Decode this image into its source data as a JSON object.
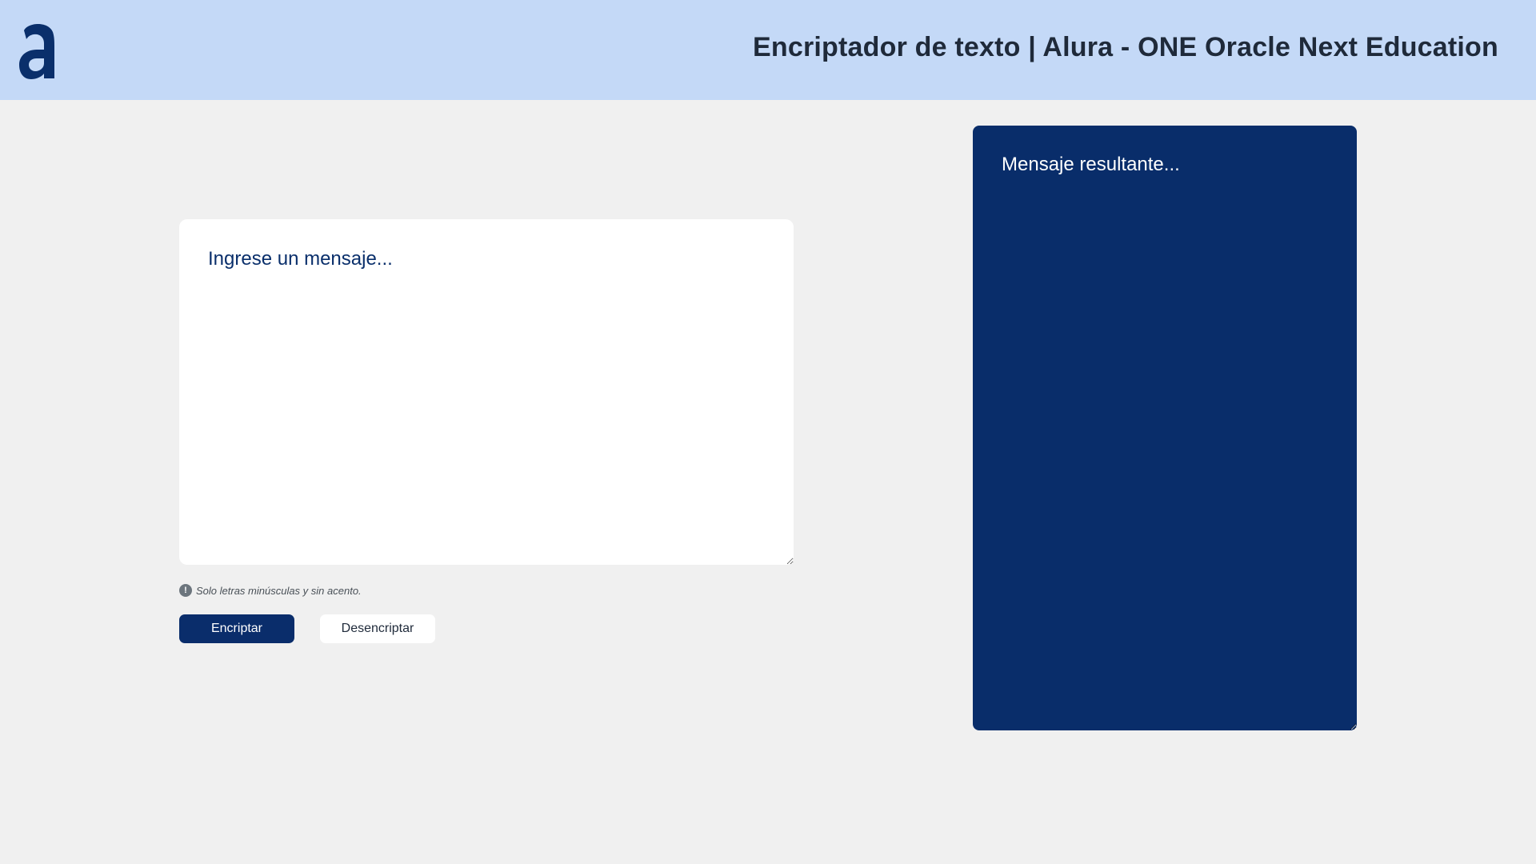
{
  "header": {
    "logo_icon": "alura-a-logo-icon",
    "title": "Encriptador de texto | Alura - ONE Oracle Next Education"
  },
  "input": {
    "placeholder": "Ingrese un mensaje...",
    "value": ""
  },
  "hint": {
    "icon": "exclamation-circle-icon",
    "text": "Solo letras minúsculas y sin acento."
  },
  "actions": {
    "encrypt_label": "Encriptar",
    "decrypt_label": "Desencriptar"
  },
  "output": {
    "placeholder": "Mensaje resultante...",
    "value": ""
  },
  "colors": {
    "header_bg": "#c4d9f7",
    "page_bg": "#f0f0f0",
    "primary": "#0a2d6b",
    "output_bg": "#092d6a"
  }
}
